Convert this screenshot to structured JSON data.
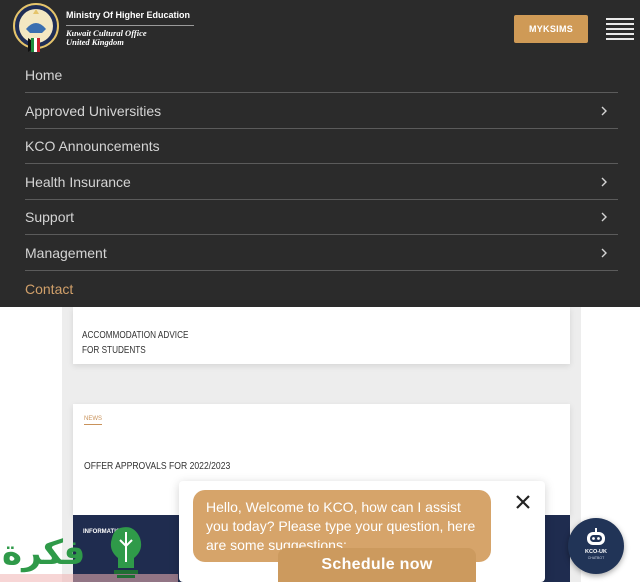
{
  "header": {
    "logo_line1": "Ministry Of Higher Education",
    "logo_line2": "Kuwait Cultural Office",
    "logo_line3": "United Kingdom",
    "myksims_label": "MYKSIMS"
  },
  "nav": {
    "items": [
      {
        "label": "Home",
        "has_submenu": false
      },
      {
        "label": "Approved Universities",
        "has_submenu": true
      },
      {
        "label": "KCO Announcements",
        "has_submenu": false
      },
      {
        "label": "Health Insurance",
        "has_submenu": true
      },
      {
        "label": "Support",
        "has_submenu": true
      },
      {
        "label": "Management",
        "has_submenu": true
      },
      {
        "label": "Contact",
        "has_submenu": false,
        "active": true
      }
    ],
    "icons": {
      "submenu": "chevron-right-icon"
    }
  },
  "cards": {
    "card1_title_line1": "ACCOMMODATION ADVICE",
    "card1_title_line2": "FOR STUDENTS",
    "card2_tag": "NEWS",
    "card2_title": "OFFER APPROVALS FOR 2022/2023",
    "card3_tag": "INFORMATION"
  },
  "chat": {
    "greeting": "Hello, Welcome to KCO, how can I assist you today? Please type your question, here are some suggestions:",
    "schedule_label": "Schedule now",
    "bot_label": "KCO-UK",
    "bot_sub": "CHATBOT"
  },
  "watermark": {
    "text": "فكرة"
  },
  "colors": {
    "header_bg": "#2b2b2b",
    "accent": "#cf9a56",
    "nav_text": "#d4d4d4",
    "active_nav": "#d1a06a",
    "bot_bg": "#213457"
  }
}
